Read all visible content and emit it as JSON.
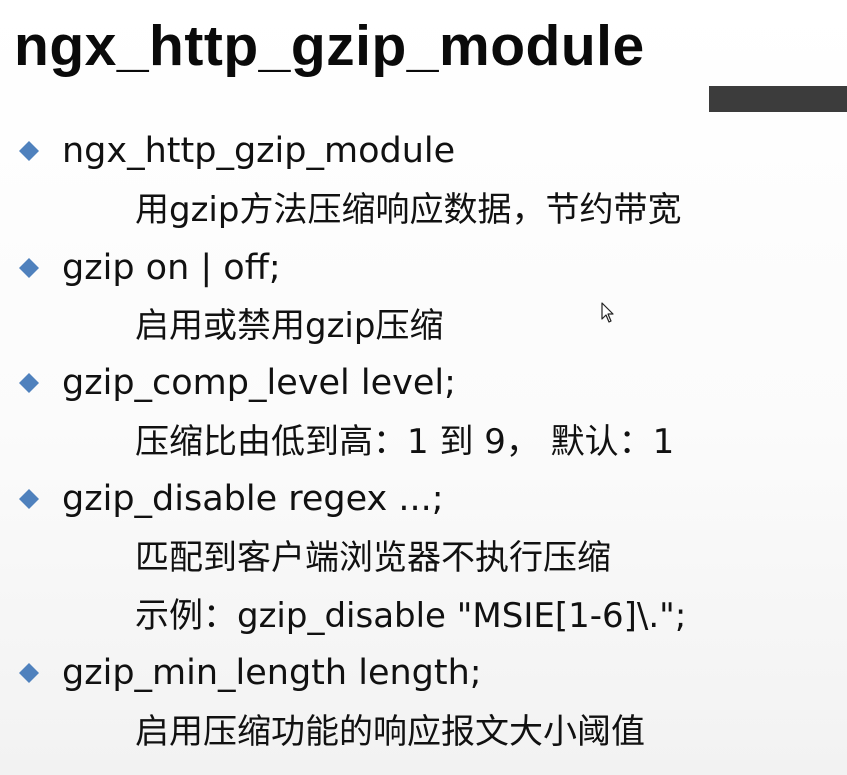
{
  "title": "ngx_http_gzip_module",
  "colors": {
    "bullet": "#4f81bd",
    "title_bar": "#3c3c3c",
    "text": "#111111"
  },
  "items": [
    {
      "directive": "ngx_http_gzip_module",
      "descriptions": [
        "用gzip方法压缩响应数据，节约带宽"
      ]
    },
    {
      "directive": "gzip on | off;",
      "descriptions": [
        "启用或禁用gzip压缩"
      ]
    },
    {
      "directive": "gzip_comp_level level;",
      "descriptions": [
        "压缩比由低到高：1 到 9， 默认：1"
      ]
    },
    {
      "directive": "gzip_disable regex ...;",
      "descriptions": [
        "匹配到客户端浏览器不执行压缩",
        "示例：gzip_disable \"MSIE[1-6]\\.\";"
      ]
    },
    {
      "directive": "gzip_min_length length;",
      "descriptions": [
        "启用压缩功能的响应报文大小阈值"
      ]
    }
  ],
  "icons": {
    "bullet": "diamond-bullet-icon",
    "cursor": "mouse-cursor-icon"
  }
}
